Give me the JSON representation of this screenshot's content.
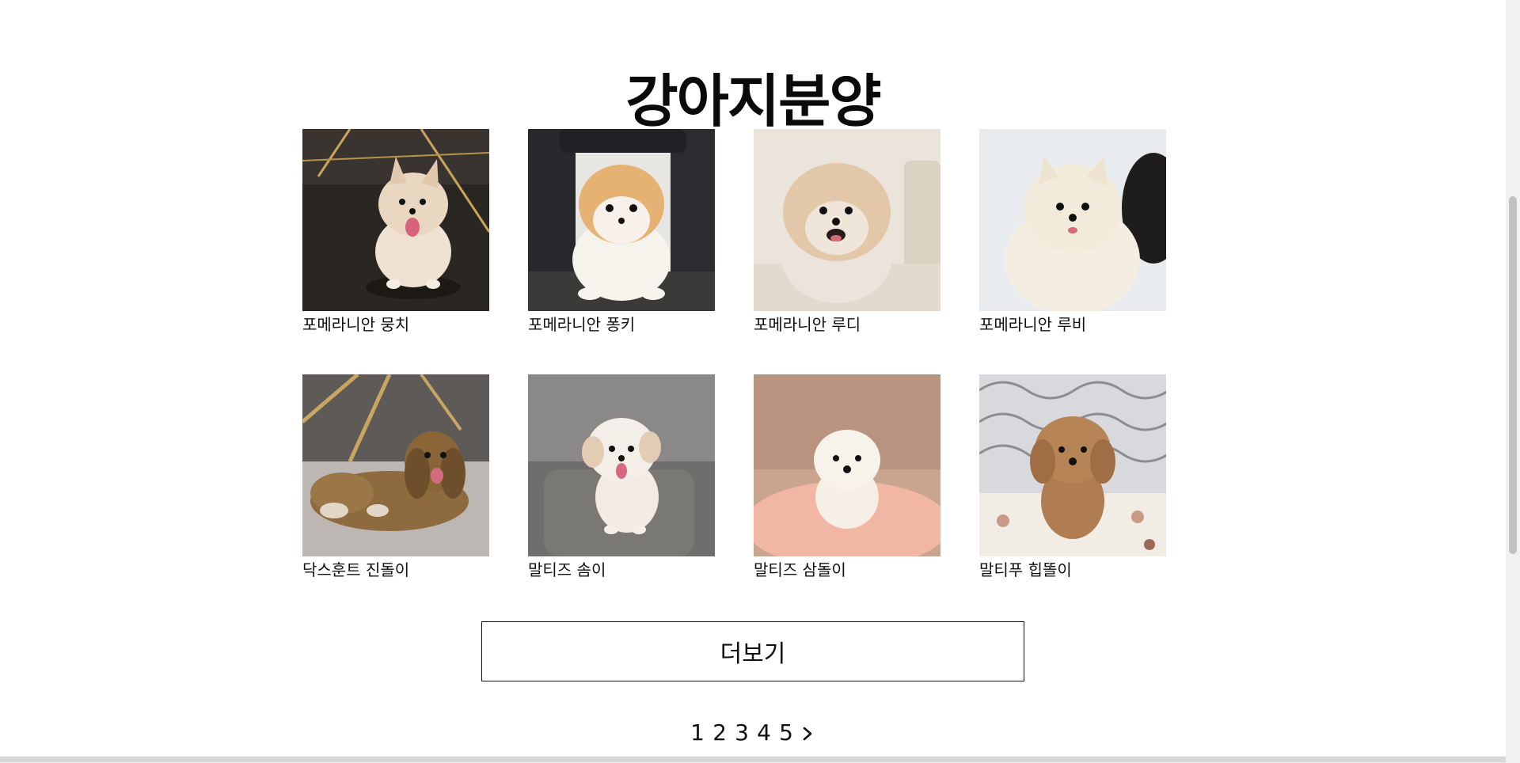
{
  "page": {
    "title": "강아지분양"
  },
  "dogs": [
    {
      "name": "포메라니안 뭉치",
      "photo": "cream-pomeranian-on-dark-floor-photo"
    },
    {
      "name": "포메라니안 퐁키",
      "photo": "orange-white-pomeranian-puppy-photo"
    },
    {
      "name": "포메라니안 루디",
      "photo": "fluffy-pomeranian-on-sofa-photo"
    },
    {
      "name": "포메라니안 루비",
      "photo": "white-pomeranian-photo"
    },
    {
      "name": "닥스훈트 진돌이",
      "photo": "long-haired-dachshund-photo"
    },
    {
      "name": "말티즈 솜이",
      "photo": "maltese-on-chair-photo"
    },
    {
      "name": "말티즈 삼돌이",
      "photo": "maltese-on-pink-blanket-photo"
    },
    {
      "name": "말티푸 힙똘이",
      "photo": "brown-maltipoo-photo"
    }
  ],
  "more_button": {
    "label": "더보기"
  },
  "pagination": {
    "pages": [
      "1",
      "2",
      "3",
      "4",
      "5"
    ],
    "next_icon": "chevron-right-icon"
  }
}
